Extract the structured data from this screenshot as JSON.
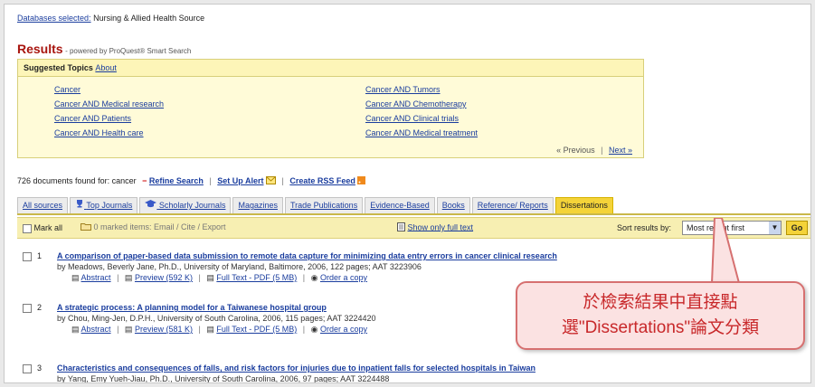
{
  "databases": {
    "label": "Databases selected:",
    "value": "Nursing & Allied Health Source"
  },
  "results": {
    "title": "Results",
    "powered": "- powered by ProQuest® Smart Search"
  },
  "suggested": {
    "label": "Suggested Topics",
    "about": "About",
    "left": [
      "Cancer",
      "Cancer AND Medical research",
      "Cancer AND Patients",
      "Cancer AND Health care"
    ],
    "right": [
      "Cancer AND Tumors",
      "Cancer AND Chemotherapy",
      "Cancer AND Clinical trials",
      "Cancer AND Medical treatment"
    ],
    "previous": "« Previous",
    "next": "Next »"
  },
  "found": {
    "text": "726 documents found for: cancer",
    "refine": "Refine Search",
    "alert": "Set Up Alert",
    "rss": "Create RSS Feed"
  },
  "tabs": [
    "All sources",
    "Top Journals",
    "Scholarly Journals",
    "Magazines",
    "Trade Publications",
    "Evidence-Based",
    "Books",
    "Reference/ Reports",
    "Dissertations"
  ],
  "toolbar": {
    "mark_all": "Mark all",
    "marked": "0 marked items: Email / Cite / Export",
    "full_text": "Show only full text",
    "sort_label": "Sort results by:",
    "sort_value": "Most recent first",
    "go": "Go"
  },
  "results_list": [
    {
      "num": "1",
      "title": "A comparison of paper-based data submission to remote data capture for minimizing data entry errors in cancer clinical research",
      "by": "by Meadows, Beverly Jane, Ph.D., University of Maryland, Baltimore, 2006, 122 pages; AAT 3223906",
      "abstract": "Abstract",
      "preview": "Preview (592 K)",
      "fulltext": "Full Text - PDF (5 MB)",
      "order": "Order a copy"
    },
    {
      "num": "2",
      "title": "A strategic process: A planning model for a Taiwanese hospital group",
      "by": "by Chou, Ming-Jen, D.P.H., University of South Carolina, 2006, 115 pages; AAT 3224420",
      "abstract": "Abstract",
      "preview": "Preview (581 K)",
      "fulltext": "Full Text - PDF (5 MB)",
      "order": "Order a copy"
    },
    {
      "num": "3",
      "title": "Characteristics and consequences of falls, and risk factors for injuries due to inpatient falls for selected hospitals in Taiwan",
      "by": "by Yang, Emy Yueh-Jiau, Ph.D., University of South Carolina, 2006, 97 pages; AAT 3224488"
    }
  ],
  "callout": {
    "line1": "於檢索結果中直接點",
    "line2": "選\"Dissertations\"論文分類"
  },
  "colors": {
    "accent": "#a8150f",
    "link": "#1a3d9e",
    "highlight": "#f4d339",
    "callout": "#c8282a"
  }
}
